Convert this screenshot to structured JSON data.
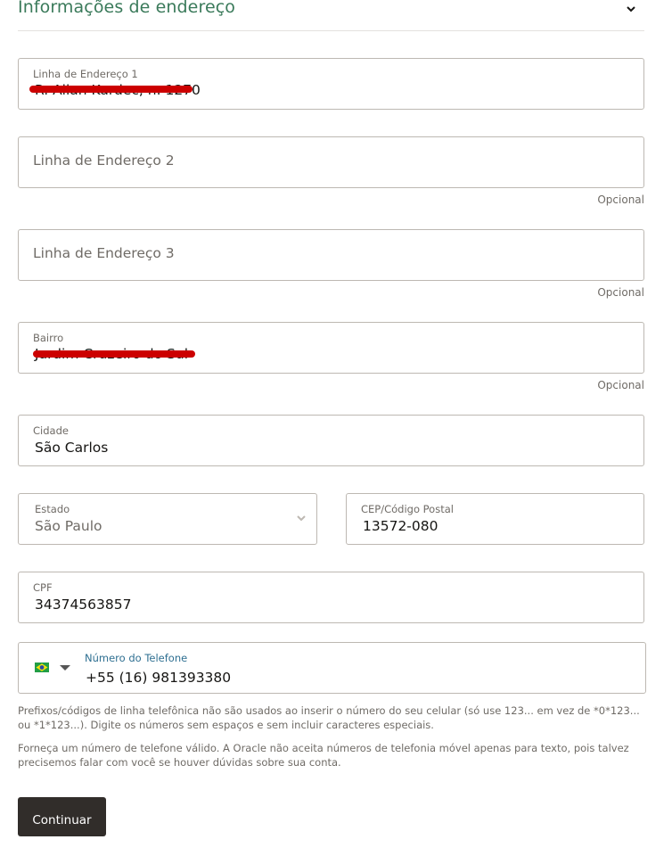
{
  "section": {
    "title": "Informações de endereço"
  },
  "address_line_1": {
    "label": "Linha de Endereço 1",
    "value": "R. Allan Kardec, n. 1270"
  },
  "address_line_2": {
    "placeholder": "Linha de Endereço 2",
    "optional": "Opcional"
  },
  "address_line_3": {
    "placeholder": "Linha de Endereço 3",
    "optional": "Opcional"
  },
  "neighborhood": {
    "label": "Bairro",
    "value": "Jardim Cruzeiro do Sul",
    "optional": "Opcional"
  },
  "city": {
    "label": "Cidade",
    "value": "São Carlos"
  },
  "state": {
    "label": "Estado",
    "value": "São Paulo"
  },
  "postal_code": {
    "label": "CEP/Código Postal",
    "value": "13572-080"
  },
  "cpf": {
    "label": "CPF",
    "value": "34374563857"
  },
  "phone": {
    "label": "Número do Telefone",
    "value": "+55 (16) 981393380",
    "country_flag": "brazil-flag-icon"
  },
  "help_text_1": "Prefixos/códigos de linha telefônica não são usados ao inserir o número do seu celular (só use 123... em vez de *0*123... ou *1*123...). Digite os números sem espaços e sem incluir caracteres especiais.",
  "help_text_2": "Forneça um número de telefone válido. A Oracle não aceita números de telefonia móvel apenas para texto, pois talvez precisemos falar com você se houver dúvidas sobre sua conta.",
  "continue_button": "Continuar",
  "colors": {
    "accent_green": "#3a7a5a",
    "border": "#bdb8b2",
    "button_bg": "#312d2a",
    "phone_label": "#2e6f91",
    "redaction": "#cc0000"
  }
}
